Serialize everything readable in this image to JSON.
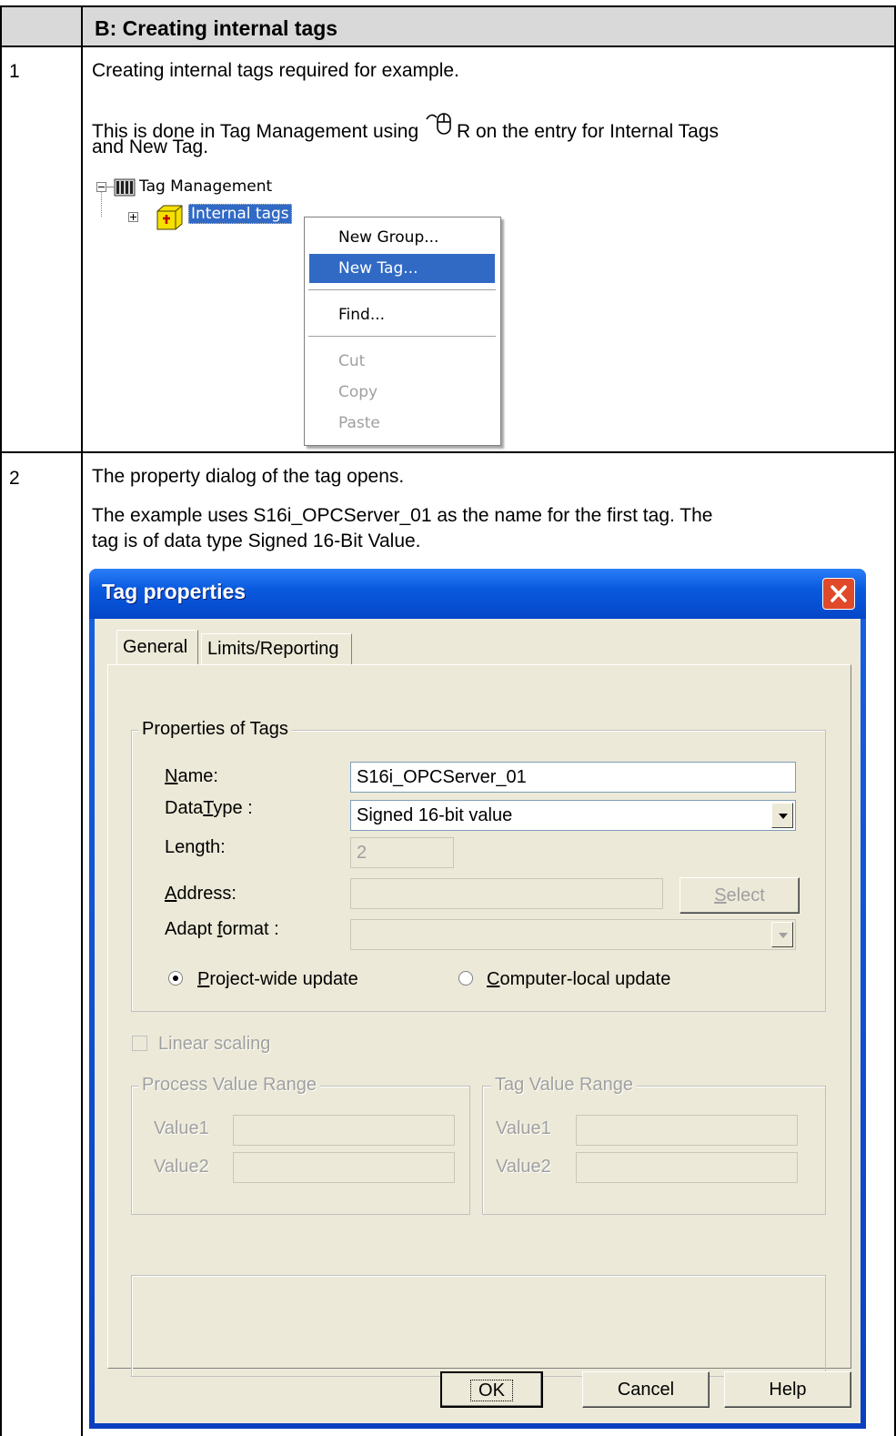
{
  "header": {
    "title": "B: Creating internal tags"
  },
  "steps": [
    {
      "number": "1",
      "line1": "Creating internal tags required for example.",
      "line2_before": "This is done in Tag Management using ",
      "line2_after": "R on the entry for Internal Tags",
      "line3": "and New Tag."
    },
    {
      "number": "2",
      "line1": "The property dialog of the tag opens.",
      "line2": "The example uses S16i_OPCServer_01 as the name for the first tag. The",
      "line3": "tag is of data type Signed 16-Bit Value."
    }
  ],
  "tree": {
    "root_label": "Tag Management",
    "child_label": "Internal tags"
  },
  "context_menu": {
    "items": [
      {
        "label": "New Group...",
        "state": "normal"
      },
      {
        "label": "New Tag...",
        "state": "highlighted"
      },
      {
        "label": "Find...",
        "state": "normal"
      },
      {
        "label": "Cut",
        "state": "disabled"
      },
      {
        "label": "Copy",
        "state": "disabled"
      },
      {
        "label": "Paste",
        "state": "disabled"
      }
    ]
  },
  "dialog": {
    "title": "Tag properties",
    "tabs": [
      "General",
      "Limits/Reporting"
    ],
    "active_tab": "General",
    "properties_group": "Properties of Tags",
    "name_label_u": "N",
    "name_label_rest": "ame:",
    "name_value": "S16i_OPCServer_01",
    "datatype_label_a": "Data",
    "datatype_label_u": "T",
    "datatype_label_b": "ype :",
    "datatype_value": "Signed 16-bit value",
    "length_label": "Length:",
    "length_value": "2",
    "address_label_u": "A",
    "address_label_rest": "ddress:",
    "address_value": "",
    "select_button_u": "S",
    "select_button_rest": "elect",
    "adapt_label_a": "Adapt ",
    "adapt_label_u": "f",
    "adapt_label_b": "ormat :",
    "adapt_value": "",
    "radio_project_u": "P",
    "radio_project_rest": "roject-wide update",
    "radio_computer_u": "C",
    "radio_computer_rest": "omputer-local update",
    "radio_selected": "project-wide",
    "linear_scaling_label": "Linear scaling",
    "linear_scaling_checked": false,
    "process_group": "Process Value Range",
    "tag_group": "Tag Value Range",
    "value1_label": "Value1",
    "value2_label": "Value2",
    "ok_label": "OK",
    "cancel_label": "Cancel",
    "help_label": "Help"
  },
  "colors": {
    "header_bg": "#d9d9d9",
    "titlebar_blue": "#0a5adf",
    "menu_highlight": "#316ac5",
    "close_red": "#e0492a",
    "dialog_bg": "#ece9d8"
  }
}
